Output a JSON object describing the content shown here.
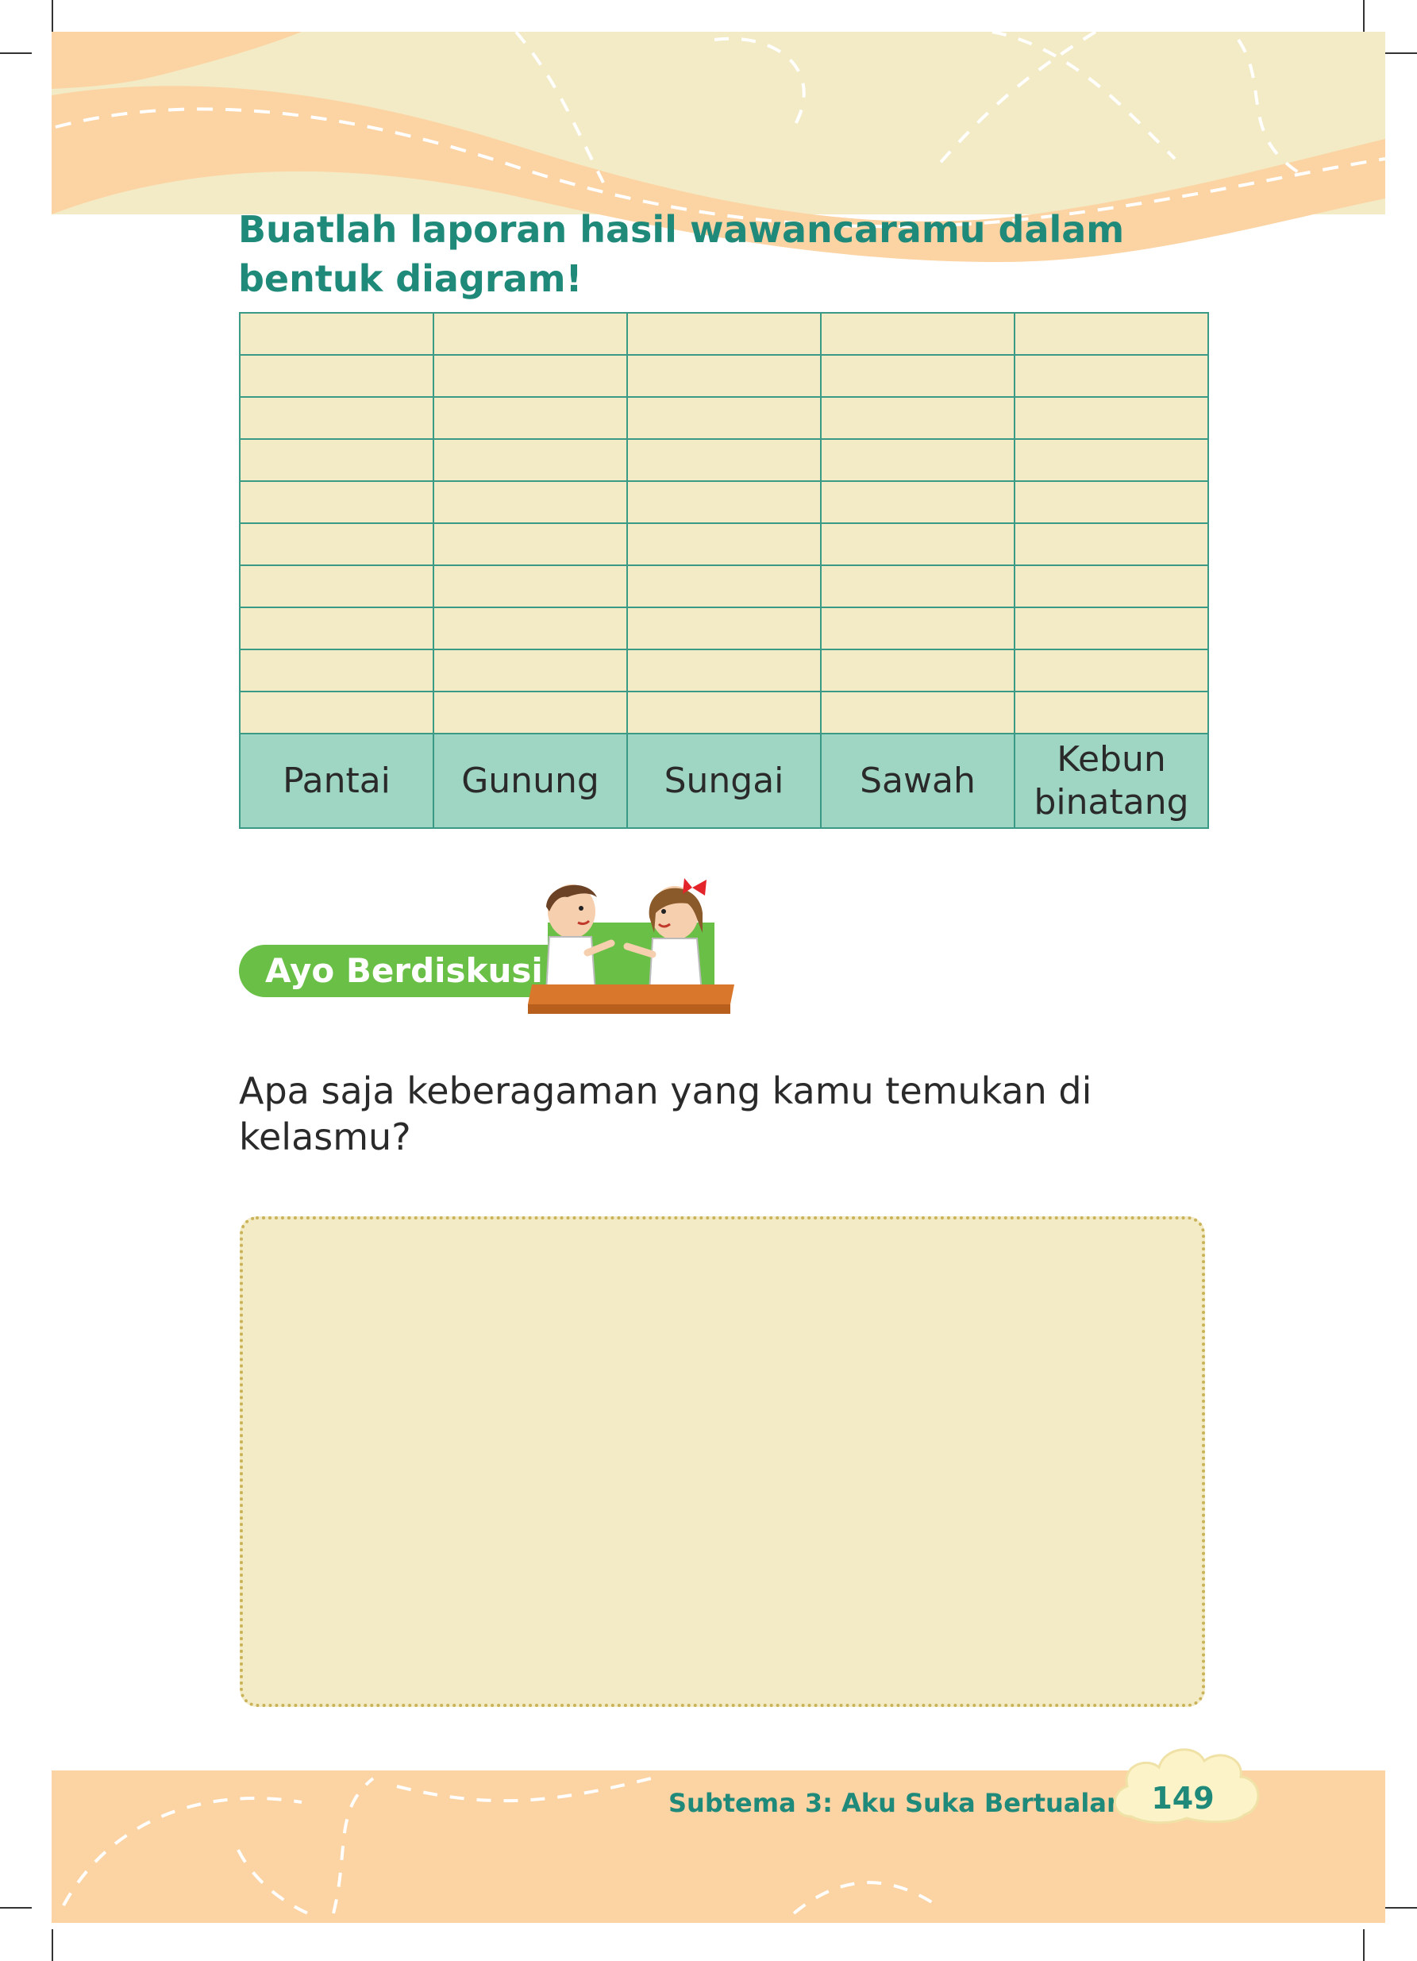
{
  "instruction": {
    "line1": "Buatlah laporan hasil wawancaramu dalam",
    "line2": "bentuk diagram!"
  },
  "diagram_table": {
    "empty_rows": 10,
    "categories": [
      "Pantai",
      "Gunung",
      "Sungai",
      "Sawah",
      "Kebun binatang"
    ]
  },
  "activity": {
    "badge_label": "Ayo Berdiskusi",
    "illustration": "two-children-discussing-at-table"
  },
  "question": {
    "line1": "Apa saja keberagaman yang kamu temukan di",
    "line2": "kelasmu?"
  },
  "footer": {
    "subtheme": "Subtema 3: Aku Suka Bertualang",
    "page_number": "149"
  },
  "colors": {
    "heading_teal": "#1f8a7a",
    "band_peach": "#fcd3a3",
    "grid_fill": "#f3ebc6",
    "label_row": "#9fd6c3",
    "badge_green": "#6ac046"
  }
}
